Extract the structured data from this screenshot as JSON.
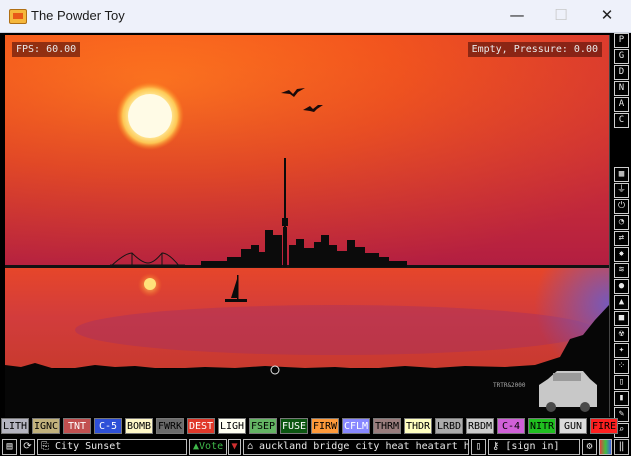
{
  "window": {
    "title": "The Powder Toy",
    "minimize": "—",
    "maximize": "☐",
    "close": "✕"
  },
  "hud": {
    "fps": "FPS: 60.00",
    "status": "Empty, Pressure: 0.00"
  },
  "sign_text": "TRTR&2000",
  "menu_buttons": [
    "P",
    "G",
    "D",
    "N",
    "A",
    "C"
  ],
  "tool_icons": [
    "wall-icon",
    "electronics-icon",
    "power-icon",
    "sensor-icon",
    "force-icon",
    "explosive-icon",
    "gas-icon",
    "liquid-icon",
    "powder-icon",
    "solid-icon",
    "radioactive-icon",
    "special-icon",
    "life-icon",
    "tools-icon",
    "favorites-icon",
    "decoration-icon",
    "search-icon"
  ],
  "elements": [
    {
      "label": "LITH",
      "bg": "#b5b5c0",
      "fg": "#000000"
    },
    {
      "label": "IGNC",
      "bg": "#c2b27d",
      "fg": "#000000"
    },
    {
      "label": "TNT",
      "bg": "#c25050",
      "fg": "#ffffff"
    },
    {
      "label": "C-5",
      "bg": "#2e50d8",
      "fg": "#ffffff"
    },
    {
      "label": "BOMB",
      "bg": "#fff8c8",
      "fg": "#000000"
    },
    {
      "label": "FWRK",
      "bg": "#6b6b6b",
      "fg": "#000000"
    },
    {
      "label": "DEST",
      "bg": "#e0382a",
      "fg": "#ffffff"
    },
    {
      "label": "LIGH",
      "bg": "#fffff2",
      "fg": "#000000"
    },
    {
      "label": "FSEP",
      "bg": "#64b464",
      "fg": "#000000"
    },
    {
      "label": "FUSE",
      "bg": "#0b5510",
      "fg": "#ffffff"
    },
    {
      "label": "FIRW",
      "bg": "#ff9a3a",
      "fg": "#000000"
    },
    {
      "label": "CFLM",
      "bg": "#8888ff",
      "fg": "#ffffff"
    },
    {
      "label": "THRM",
      "bg": "#9a7d7d",
      "fg": "#000000"
    },
    {
      "label": "THDR",
      "bg": "#ffffc0",
      "fg": "#000000"
    },
    {
      "label": "LRBD",
      "bg": "#ababab",
      "fg": "#000000"
    },
    {
      "label": "RBDM",
      "bg": "#cccccc",
      "fg": "#000000"
    },
    {
      "label": "C-4",
      "bg": "#d060d8",
      "fg": "#000000"
    },
    {
      "label": "NITR",
      "bg": "#20c020",
      "fg": "#000000"
    },
    {
      "label": "GUN",
      "bg": "#dcdcdc",
      "fg": "#000000"
    },
    {
      "label": "FIRE",
      "bg": "#ff2020",
      "fg": "#000000"
    }
  ],
  "bottom": {
    "save_name": "City Sunset",
    "vote_label": "Vote",
    "tags": "auckland bridge city heat heatart heatgr...",
    "sign_in": "[sign in]"
  }
}
